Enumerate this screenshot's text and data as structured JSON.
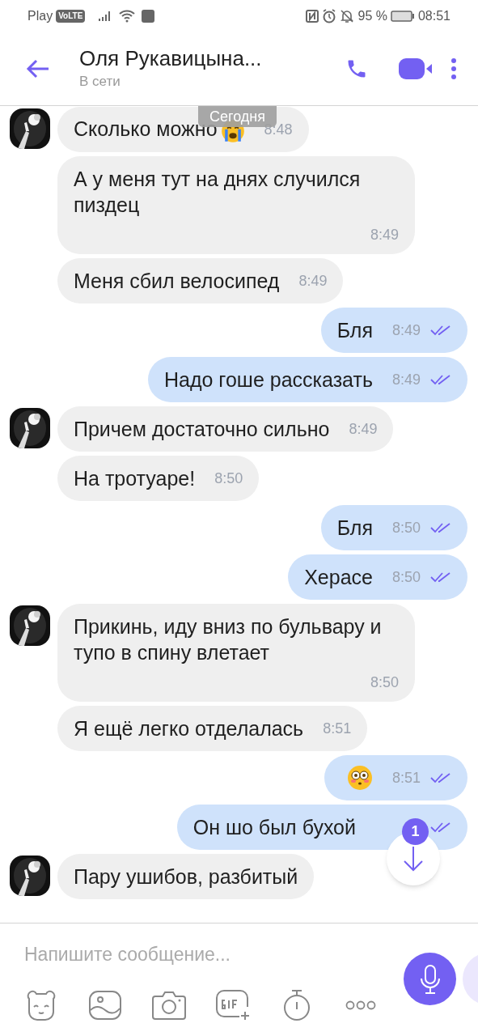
{
  "status_bar": {
    "carrier": "Play",
    "network_badge": "VoLTE",
    "battery": "95 %",
    "time": "08:51"
  },
  "header": {
    "title": "Оля Рукавицына...",
    "status": "В сети"
  },
  "date_label": "Сегодня",
  "messages": [
    {
      "kind": "in",
      "avatar": true,
      "text": "Сколько можно",
      "emoji": {
        "kind": "crying"
      },
      "time": "8:48",
      "time_below": false
    },
    {
      "kind": "in",
      "avatar": false,
      "text": "А у меня тут на днях случился пиздец",
      "time": "8:49",
      "time_below": true
    },
    {
      "kind": "in",
      "avatar": false,
      "text": "Меня сбил велосипед",
      "time": "8:49",
      "time_below": false
    },
    {
      "kind": "out",
      "text": "Бля",
      "time": "8:49",
      "read": true,
      "time_below": false
    },
    {
      "kind": "out",
      "text": "Надо гоше рассказать",
      "time": "8:49",
      "read": true,
      "time_below": false
    },
    {
      "kind": "in",
      "avatar": true,
      "text": "Причем достаточно сильно",
      "time": "8:49",
      "time_below": false
    },
    {
      "kind": "in",
      "avatar": false,
      "text": "На тротуаре!",
      "time": "8:50",
      "time_below": false
    },
    {
      "kind": "out",
      "text": "Бля",
      "time": "8:50",
      "read": true,
      "time_below": false
    },
    {
      "kind": "out",
      "text": "Херасе",
      "time": "8:50",
      "read": true,
      "time_below": false
    },
    {
      "kind": "in",
      "avatar": true,
      "text": "Прикинь, иду вниз по бульвару и тупо в спину влетает",
      "time": "8:50",
      "time_below": true
    },
    {
      "kind": "in",
      "avatar": false,
      "text": "Я ещё легко отделалась",
      "time": "8:51",
      "time_below": false
    },
    {
      "kind": "out",
      "emoji": {
        "kind": "flushed"
      },
      "time": "8:51",
      "read": true,
      "time_below": false
    },
    {
      "kind": "out",
      "text": "Он шо был бухой",
      "read": true,
      "time_below": false
    },
    {
      "kind": "in",
      "avatar": true,
      "text": "Пару ушибов, разбитый",
      "time_below": false
    }
  ],
  "scroll_button": {
    "badge": "1"
  },
  "composer": {
    "placeholder": "Напишите сообщение..."
  }
}
